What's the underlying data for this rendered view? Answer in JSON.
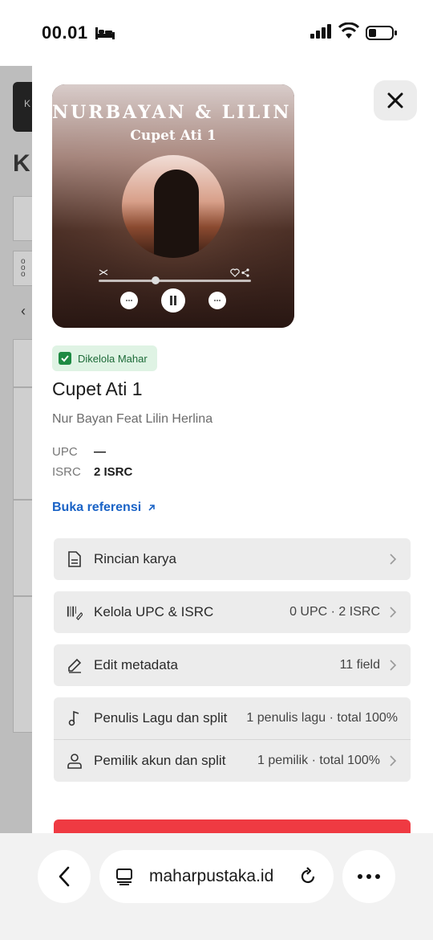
{
  "status_bar": {
    "time": "00.01"
  },
  "cover": {
    "title_text": "NURBAYAN & LILIN H",
    "subtitle_text": "Cupet Ati 1"
  },
  "badge": {
    "label": "Dikelola Mahar",
    "color": "#1e8a43"
  },
  "release": {
    "title": "Cupet Ati 1",
    "artist": "Nur Bayan Feat Lilin Herlina",
    "upc_label": "UPC",
    "upc_value": "—",
    "isrc_label": "ISRC",
    "isrc_value": "2 ISRC"
  },
  "reference_link": {
    "label": "Buka referensi",
    "color": "#1a63c6"
  },
  "menu": {
    "rincian": {
      "label": "Rincian karya"
    },
    "kelola": {
      "label": "Kelola UPC & ISRC",
      "value": "0 UPC · 2 ISRC"
    },
    "edit": {
      "label": "Edit metadata",
      "value": "11 field"
    },
    "penulis": {
      "label": "Penulis Lagu dan split",
      "value": "1 penulis lagu · total 100%"
    },
    "pemilik": {
      "label": "Pemilik akun dan split",
      "value": "1 pemilik · total 100%"
    }
  },
  "accent_colors": {
    "danger": "#ef3a42"
  },
  "browser": {
    "url": "maharpustaka.id"
  },
  "background_page": {
    "heading_letter": "K",
    "tab_letter": "K"
  }
}
